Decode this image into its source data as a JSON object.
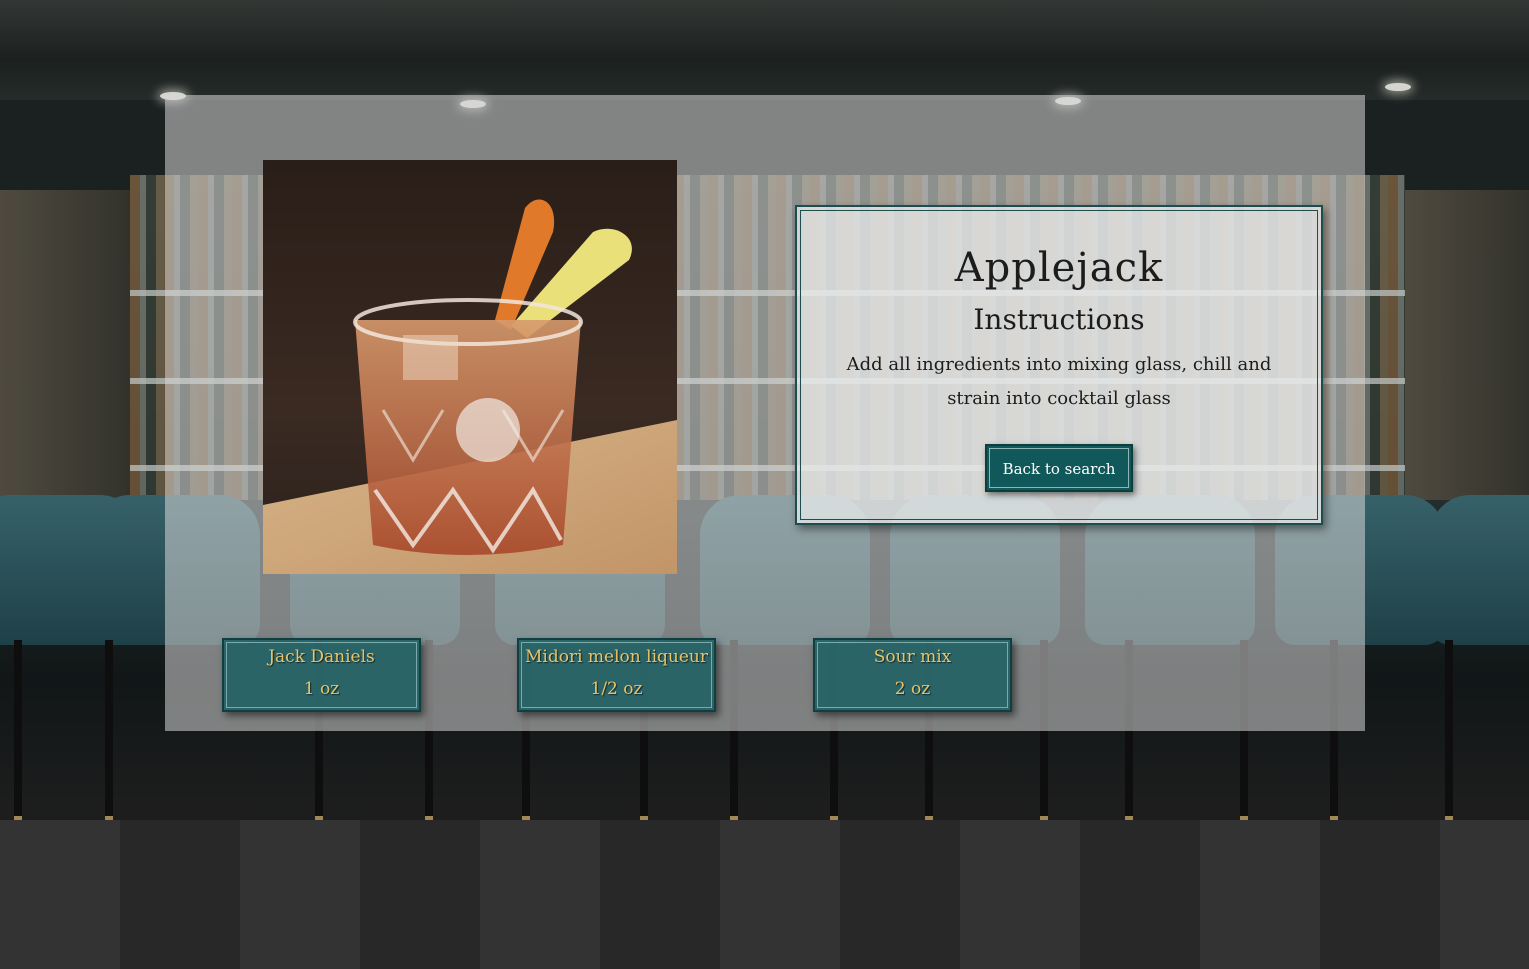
{
  "drink": {
    "name": "Applejack",
    "instructions_heading": "Instructions",
    "instructions": "Add all ingredients into mixing glass, chill and strain into cocktail glass",
    "back_button_label": "Back to search",
    "image_alt": "cocktail-photo"
  },
  "ingredients": [
    {
      "name": "Jack Daniels",
      "measure": "1 oz"
    },
    {
      "name": "Midori melon liqueur",
      "measure": "1/2 oz"
    },
    {
      "name": "Sour mix",
      "measure": "2 oz"
    }
  ],
  "colors": {
    "accent_teal": "#11585a",
    "ingredient_text": "#e8c36a",
    "overlay": "#d7d7d7"
  }
}
